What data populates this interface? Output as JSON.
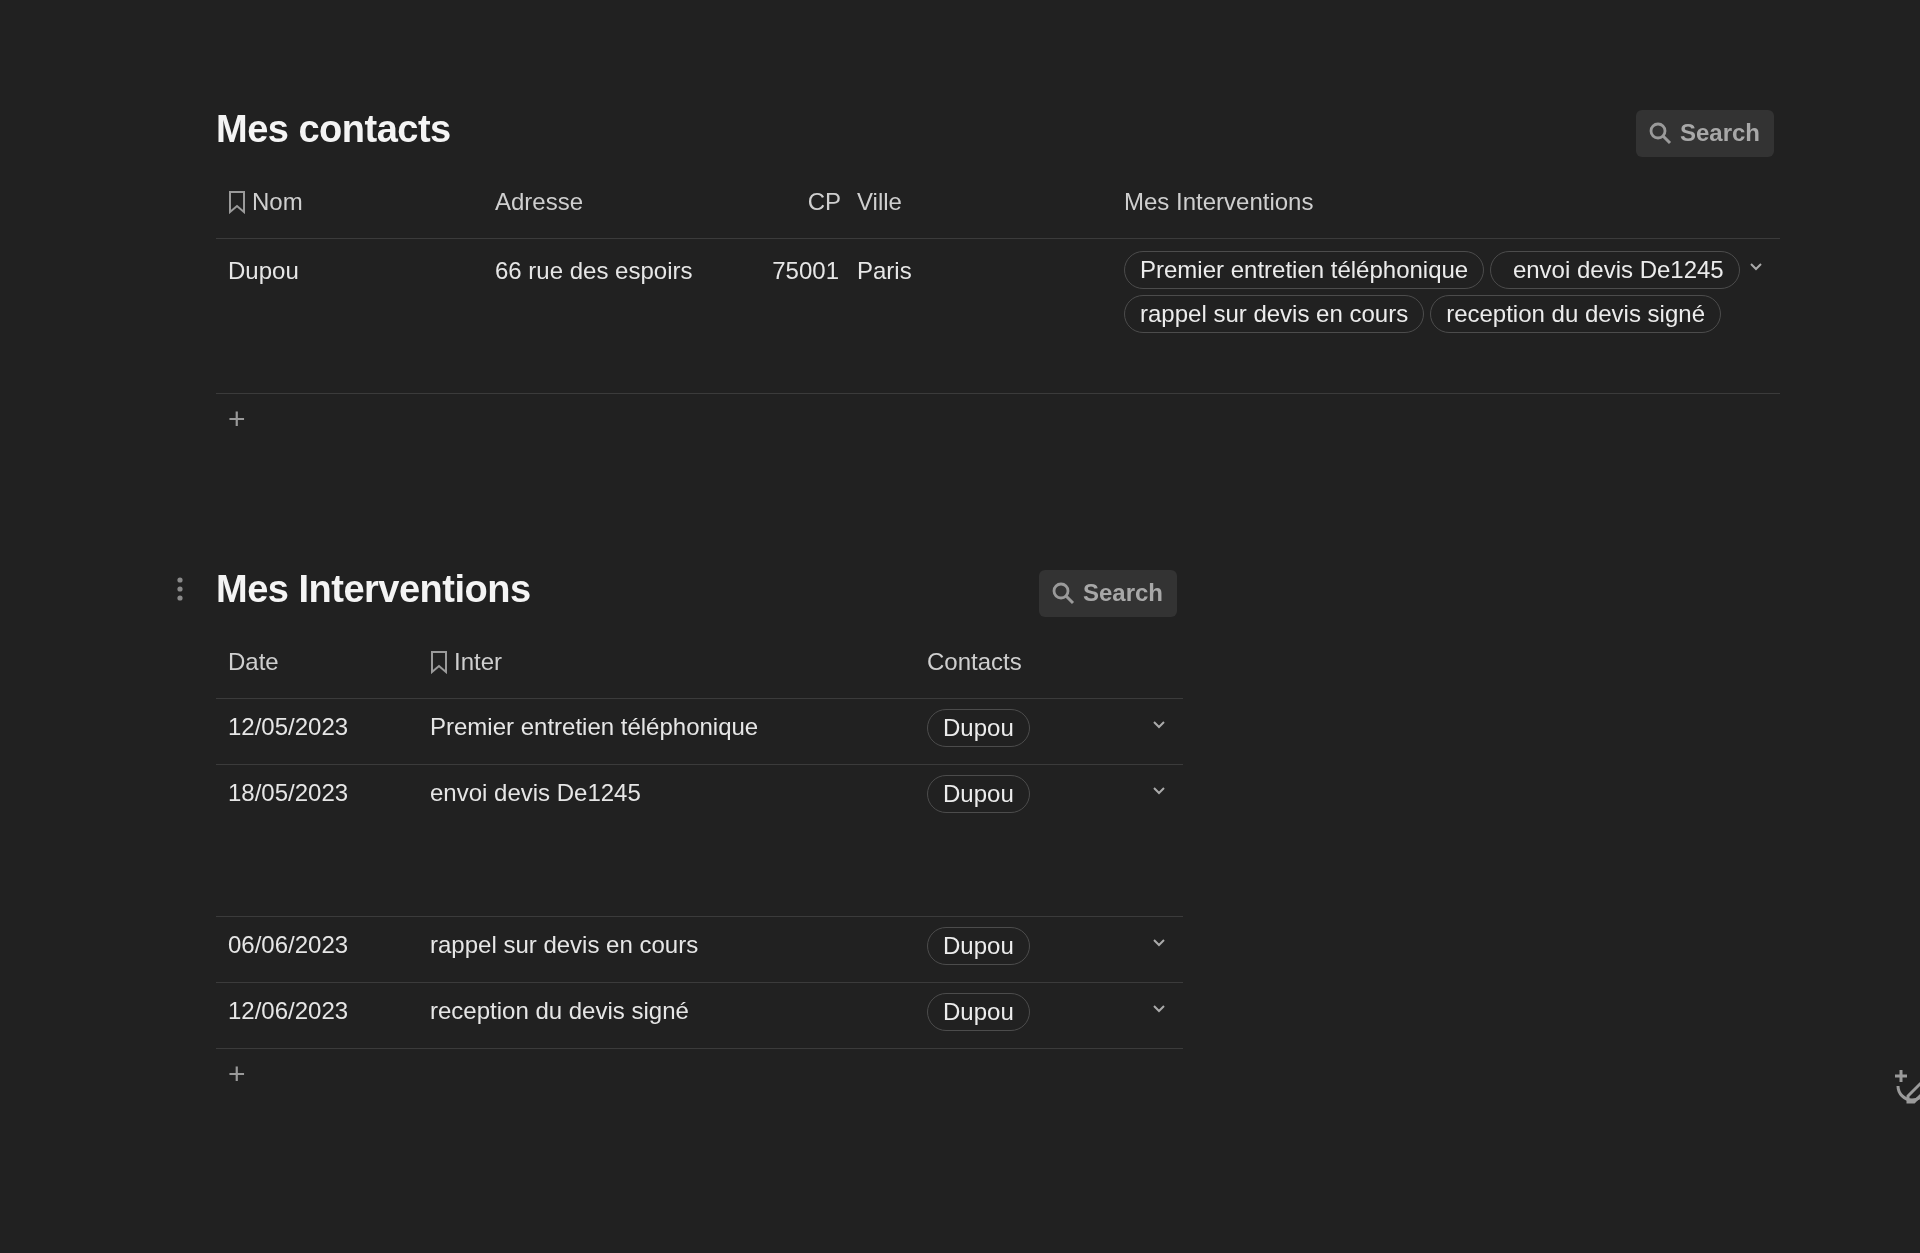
{
  "contacts": {
    "title": "Mes contacts",
    "search": {
      "label": "Search"
    },
    "columns": [
      {
        "label": "Nom",
        "kind": "title"
      },
      {
        "label": "Adresse",
        "kind": "text"
      },
      {
        "label": "CP",
        "kind": "number"
      },
      {
        "label": "Ville",
        "kind": "text"
      },
      {
        "label": "Mes Interventions",
        "kind": "relation"
      }
    ],
    "rows": [
      {
        "cells": [
          "Dupou",
          "66 rue des espoirs",
          "75001",
          "Paris"
        ],
        "tags": [
          "Premier entretien téléphonique",
          " envoi devis De1245",
          "rappel sur devis en cours",
          "reception du devis signé"
        ]
      }
    ],
    "add": "+"
  },
  "interventions": {
    "title": "Mes Interventions",
    "search": {
      "label": "Search"
    },
    "columns": [
      {
        "label": "Date",
        "kind": "text"
      },
      {
        "label": "Inter",
        "kind": "title"
      },
      {
        "label": "Contacts",
        "kind": "relation"
      }
    ],
    "rows": [
      {
        "cells": [
          "12/05/2023",
          "Premier entretien téléphonique"
        ],
        "tags": [
          "Dupou"
        ]
      },
      {
        "cells": [
          "18/05/2023",
          " envoi devis De1245"
        ],
        "tags": [
          "Dupou"
        ]
      },
      {
        "cells": [
          "06/06/2023",
          "rappel sur devis en cours"
        ],
        "tags": [
          "Dupou"
        ]
      },
      {
        "cells": [
          "12/06/2023",
          "reception du devis signé"
        ],
        "tags": [
          "Dupou"
        ]
      }
    ],
    "add": "+"
  }
}
